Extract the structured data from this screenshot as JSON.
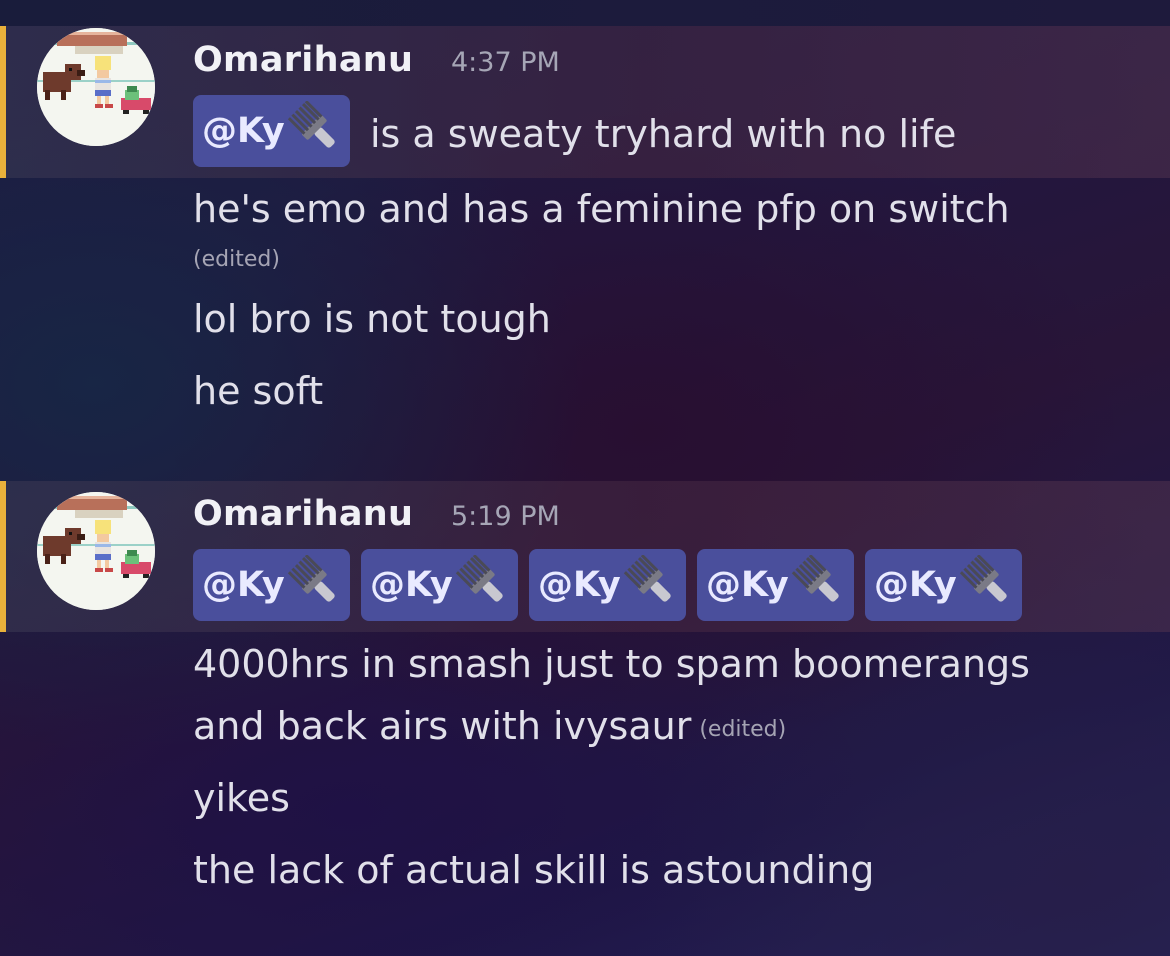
{
  "messages": [
    {
      "username": "Omarihanu",
      "time": "4:37 PM",
      "mention": "@Ky",
      "first_line_rest": "is a sweaty tryhard with no life",
      "lines": [
        "he's emo and has a feminine pfp on switch",
        "(edited)",
        "lol bro is not tough",
        "he soft"
      ]
    },
    {
      "username": "Omarihanu",
      "time": "5:19 PM",
      "mentions": [
        "@Ky",
        "@Ky",
        "@Ky",
        "@Ky",
        "@Ky"
      ],
      "lines": [
        "4000hrs in smash just to spam boomerangs",
        "and back airs with ivysaur",
        "(edited)",
        "yikes",
        "the lack of actual skill is astounding"
      ]
    }
  ],
  "colors": {
    "highlight_bar": "#e9b13b",
    "mention_bg": "#4a4f9c"
  },
  "icons": {
    "mention_emoji": "hair-pick-icon",
    "avatar": "pixel-art-avatar"
  }
}
